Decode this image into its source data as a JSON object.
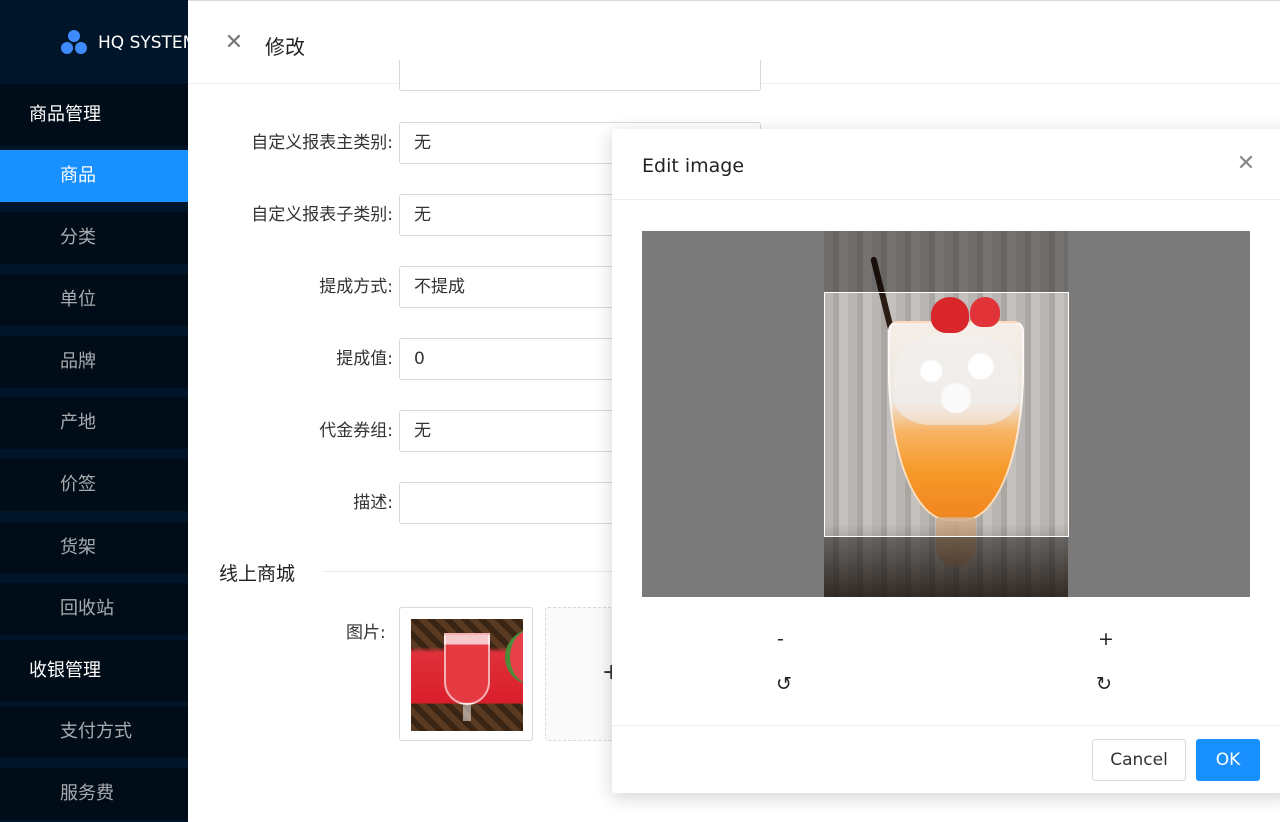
{
  "app": {
    "logo_text": "HQ SYSTEM"
  },
  "sidebar": {
    "groups": [
      {
        "label": "商品管理"
      },
      {
        "label": "收银管理"
      }
    ],
    "items": [
      {
        "label": "商品"
      },
      {
        "label": "分类"
      },
      {
        "label": "单位"
      },
      {
        "label": "品牌"
      },
      {
        "label": "产地"
      },
      {
        "label": "价签"
      },
      {
        "label": "货架"
      },
      {
        "label": "回收站"
      },
      {
        "label": "支付方式"
      },
      {
        "label": "服务费"
      }
    ]
  },
  "drawer": {
    "title": "修改",
    "form": [
      {
        "label": "自定义报表主类别:",
        "value": "无"
      },
      {
        "label": "自定义报表子类别:",
        "value": "无"
      },
      {
        "label": "提成方式:",
        "value": "不提成"
      },
      {
        "label": "提成值:",
        "value": "0"
      },
      {
        "label": "代金券组:",
        "value": "无"
      },
      {
        "label": "描述:",
        "value": ""
      }
    ],
    "section_title": "线上商城",
    "picture_label": "图片:",
    "upload_plus": "+"
  },
  "modal": {
    "title": "Edit image",
    "zoom_out": "-",
    "zoom_in": "+",
    "rotate_left": "↺",
    "rotate_right": "↻",
    "cancel_label": "Cancel",
    "ok_label": "OK"
  },
  "colors": {
    "accent": "#1890ff",
    "sidebar_bg": "#001529"
  },
  "icons": {
    "close": "close-icon",
    "logo": "logo-icon"
  }
}
